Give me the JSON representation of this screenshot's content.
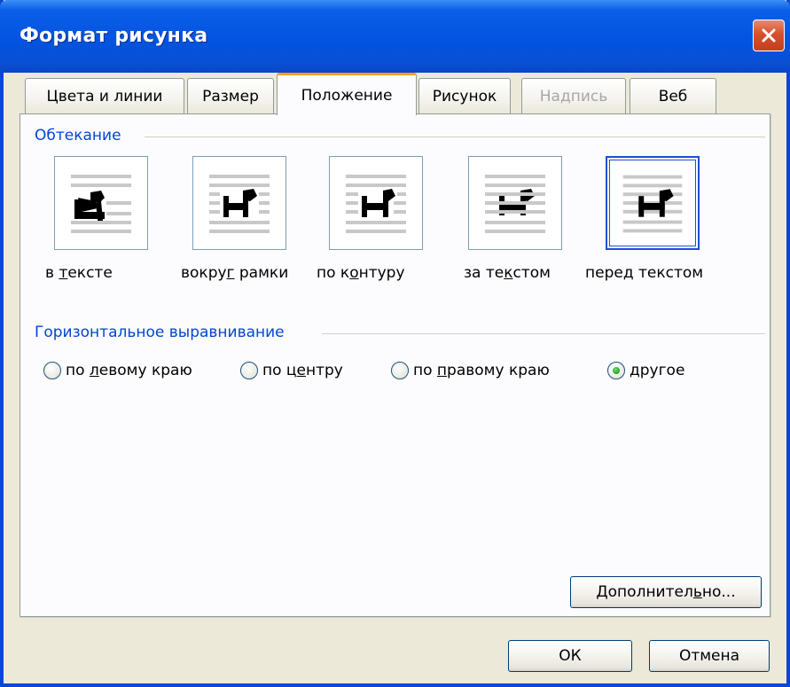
{
  "window": {
    "title": "Формат рисунка"
  },
  "tabs": [
    {
      "label": "Цвета и линии",
      "state": "normal"
    },
    {
      "label": "Размер",
      "state": "normal"
    },
    {
      "label": "Положение",
      "state": "active"
    },
    {
      "label": "Рисунок",
      "state": "normal"
    },
    {
      "label": "Надпись",
      "state": "disabled"
    },
    {
      "label": "Веб",
      "state": "normal"
    }
  ],
  "wrapping": {
    "group_label": "Обтекание",
    "options": [
      {
        "label_pre": "в ",
        "label_u": "т",
        "label_post": "ексте",
        "icon": "in-line-with-text-icon",
        "selected": false
      },
      {
        "label_pre": "вокру",
        "label_u": "г",
        "label_post": " рамки",
        "icon": "square-wrap-icon",
        "selected": false
      },
      {
        "label_pre": "по к",
        "label_u": "о",
        "label_post": "нтуру",
        "icon": "tight-wrap-icon",
        "selected": false
      },
      {
        "label_pre": "за те",
        "label_u": "к",
        "label_post": "стом",
        "icon": "behind-text-icon",
        "selected": false
      },
      {
        "label_pre": "пере",
        "label_u": "д",
        "label_post": " текстом",
        "icon": "in-front-of-text-icon",
        "selected": true
      }
    ]
  },
  "alignment": {
    "group_label": "Горизонтальное выравнивание",
    "options": [
      {
        "label_pre": "по ",
        "label_u": "л",
        "label_post": "евому краю",
        "checked": false
      },
      {
        "label_pre": "по ц",
        "label_u": "е",
        "label_post": "нтру",
        "checked": false
      },
      {
        "label_pre": "по ",
        "label_u": "п",
        "label_post": "равому краю",
        "checked": false
      },
      {
        "label_pre": "",
        "label_u": "д",
        "label_post": "ругое",
        "checked": true
      }
    ]
  },
  "buttons": {
    "advanced": {
      "pre": "Дополнител",
      "u": "ь",
      "post": "но..."
    },
    "ok": "ОК",
    "cancel": "Отмена"
  },
  "colors": {
    "title_bar": "#0354e0",
    "accent_blue": "#0046d5",
    "active_tab_top": "#f5a020",
    "close_button": "#d7502b"
  }
}
